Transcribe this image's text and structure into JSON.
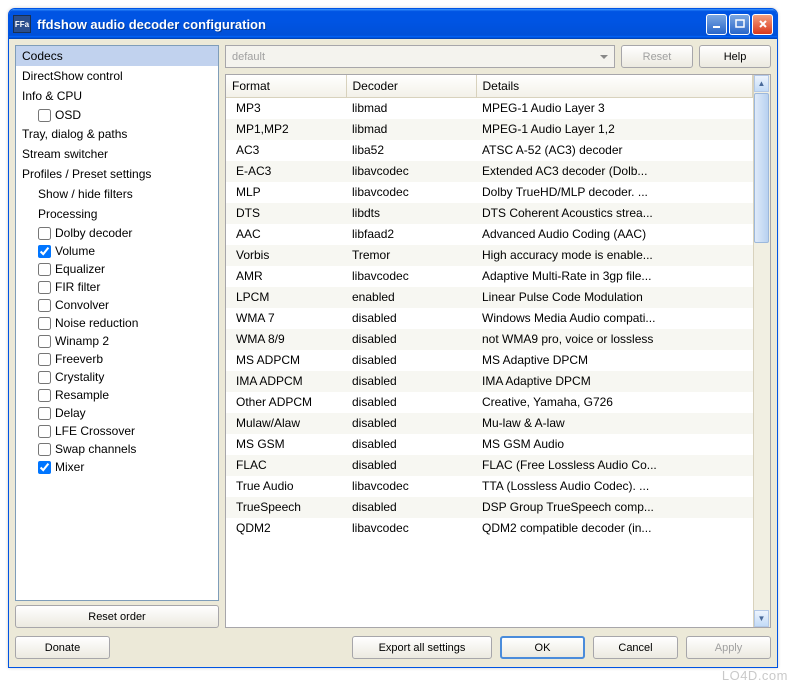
{
  "window": {
    "title": "ffdshow audio decoder configuration",
    "icon_text": "FFa"
  },
  "toolbar": {
    "preset_value": "default",
    "reset_label": "Reset",
    "help_label": "Help"
  },
  "sidebar": {
    "reset_order_label": "Reset order",
    "items": [
      {
        "label": "Codecs",
        "level": 0,
        "selected": true,
        "check": null
      },
      {
        "label": "DirectShow control",
        "level": 0,
        "check": null
      },
      {
        "label": "Info & CPU",
        "level": 0,
        "check": null
      },
      {
        "label": "OSD",
        "level": 1,
        "check": false
      },
      {
        "label": "Tray, dialog & paths",
        "level": 0,
        "check": null
      },
      {
        "label": "Stream switcher",
        "level": 0,
        "check": null
      },
      {
        "label": "Profiles / Preset settings",
        "level": 0,
        "check": null
      },
      {
        "label": "Show / hide filters",
        "level": 1,
        "check": null
      },
      {
        "label": "Processing",
        "level": 1,
        "check": null
      },
      {
        "label": "Dolby decoder",
        "level": 1,
        "check": false
      },
      {
        "label": "Volume",
        "level": 1,
        "check": true
      },
      {
        "label": "Equalizer",
        "level": 1,
        "check": false
      },
      {
        "label": "FIR filter",
        "level": 1,
        "check": false
      },
      {
        "label": "Convolver",
        "level": 1,
        "check": false
      },
      {
        "label": "Noise reduction",
        "level": 1,
        "check": false
      },
      {
        "label": "Winamp 2",
        "level": 1,
        "check": false
      },
      {
        "label": "Freeverb",
        "level": 1,
        "check": false
      },
      {
        "label": "Crystality",
        "level": 1,
        "check": false
      },
      {
        "label": "Resample",
        "level": 1,
        "check": false
      },
      {
        "label": "Delay",
        "level": 1,
        "check": false
      },
      {
        "label": "LFE Crossover",
        "level": 1,
        "check": false
      },
      {
        "label": "Swap channels",
        "level": 1,
        "check": false
      },
      {
        "label": "Mixer",
        "level": 1,
        "check": true
      }
    ]
  },
  "table": {
    "columns": [
      "Format",
      "Decoder",
      "Details"
    ],
    "rows": [
      {
        "format": "MP3",
        "decoder": "libmad",
        "details": "MPEG-1 Audio Layer 3"
      },
      {
        "format": "MP1,MP2",
        "decoder": "libmad",
        "details": "MPEG-1 Audio Layer 1,2"
      },
      {
        "format": "AC3",
        "decoder": "liba52",
        "details": "ATSC A-52 (AC3) decoder"
      },
      {
        "format": "E-AC3",
        "decoder": "libavcodec",
        "details": "Extended AC3 decoder (Dolb..."
      },
      {
        "format": "MLP",
        "decoder": "libavcodec",
        "details": "Dolby TrueHD/MLP decoder. ..."
      },
      {
        "format": "DTS",
        "decoder": "libdts",
        "details": "DTS Coherent Acoustics strea..."
      },
      {
        "format": "AAC",
        "decoder": "libfaad2",
        "details": "Advanced Audio Coding (AAC)"
      },
      {
        "format": "Vorbis",
        "decoder": "Tremor",
        "details": "High accuracy mode is enable..."
      },
      {
        "format": "AMR",
        "decoder": "libavcodec",
        "details": "Adaptive Multi-Rate in 3gp file..."
      },
      {
        "format": "LPCM",
        "decoder": "enabled",
        "details": "Linear Pulse Code Modulation"
      },
      {
        "format": "WMA 7",
        "decoder": "disabled",
        "details": "Windows Media Audio compati..."
      },
      {
        "format": "WMA 8/9",
        "decoder": "disabled",
        "details": "not WMA9 pro, voice or lossless"
      },
      {
        "format": "MS ADPCM",
        "decoder": "disabled",
        "details": "MS Adaptive DPCM"
      },
      {
        "format": "IMA ADPCM",
        "decoder": "disabled",
        "details": "IMA Adaptive DPCM"
      },
      {
        "format": "Other ADPCM",
        "decoder": "disabled",
        "details": "Creative, Yamaha, G726"
      },
      {
        "format": "Mulaw/Alaw",
        "decoder": "disabled",
        "details": "Mu-law & A-law"
      },
      {
        "format": "MS GSM",
        "decoder": "disabled",
        "details": "MS GSM Audio"
      },
      {
        "format": "FLAC",
        "decoder": "disabled",
        "details": "FLAC (Free Lossless Audio Co..."
      },
      {
        "format": "True Audio",
        "decoder": "libavcodec",
        "details": "TTA (Lossless Audio Codec). ..."
      },
      {
        "format": "TrueSpeech",
        "decoder": "disabled",
        "details": "DSP Group TrueSpeech comp..."
      },
      {
        "format": "QDM2",
        "decoder": "libavcodec",
        "details": "QDM2 compatible decoder (in..."
      }
    ]
  },
  "buttons": {
    "donate": "Donate",
    "export": "Export all settings",
    "ok": "OK",
    "cancel": "Cancel",
    "apply": "Apply"
  },
  "watermark": "LO4D.com"
}
